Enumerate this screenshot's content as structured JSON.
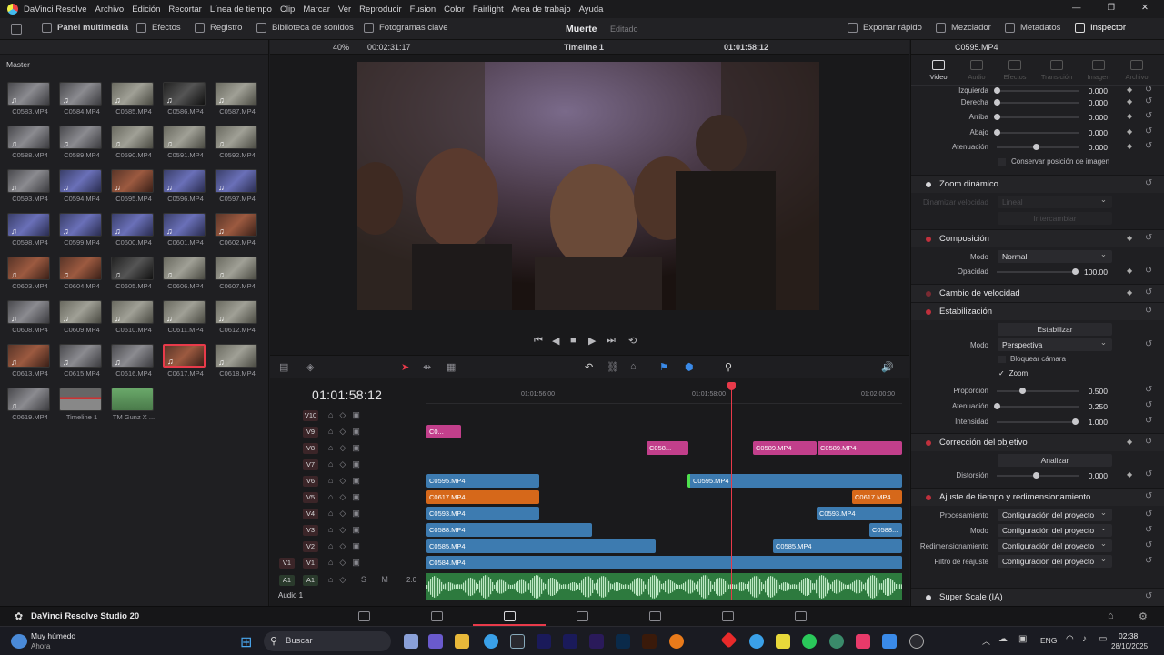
{
  "menubar": {
    "app_name": "DaVinci Resolve",
    "items": [
      "Archivo",
      "Edición",
      "Recortar",
      "Línea de tiempo",
      "Clip",
      "Marcar",
      "Ver",
      "Reproducir",
      "Fusion",
      "Color",
      "Fairlight",
      "Área de trabajo",
      "Ayuda"
    ]
  },
  "toolbar": {
    "left": [
      "Panel multimedia",
      "Efectos",
      "Registro",
      "Biblioteca de sonidos",
      "Fotogramas clave"
    ],
    "project_title": "Muerte",
    "edited_label": "Editado",
    "right": [
      "Exportar rápido",
      "Mezclador",
      "Metadatos",
      "Inspector"
    ]
  },
  "media_pool": {
    "bin": "Master",
    "clips": [
      "C0583.MP4",
      "C0584.MP4",
      "C0585.MP4",
      "C0586.MP4",
      "C0587.MP4",
      "C0588.MP4",
      "C0589.MP4",
      "C0590.MP4",
      "C0591.MP4",
      "C0592.MP4",
      "C0593.MP4",
      "C0594.MP4",
      "C0595.MP4",
      "C0596.MP4",
      "C0597.MP4",
      "C0598.MP4",
      "C0599.MP4",
      "C0600.MP4",
      "C0601.MP4",
      "C0602.MP4",
      "C0603.MP4",
      "C0604.MP4",
      "C0605.MP4",
      "C0606.MP4",
      "C0607.MP4",
      "C0608.MP4",
      "C0609.MP4",
      "C0610.MP4",
      "C0611.MP4",
      "C0612.MP4",
      "C0613.MP4",
      "C0615.MP4",
      "C0616.MP4",
      "C0617.MP4",
      "C0618.MP4",
      "C0619.MP4",
      "Timeline 1",
      "TM Gunz X ..."
    ],
    "selected": "C0617.MP4"
  },
  "viewer": {
    "zoom": "40%",
    "source_tc": "00:02:31:17",
    "timeline_name": "Timeline 1",
    "record_tc": "01:01:58:12"
  },
  "timeline": {
    "timecode": "01:01:58:12",
    "ruler": [
      "01:01:56:00",
      "01:01:58:00",
      "01:02:00:00"
    ],
    "tracks": [
      "V10",
      "V9",
      "V8",
      "V7",
      "V6",
      "V5",
      "V4",
      "V3",
      "V2",
      "V1"
    ],
    "audio_track": "A1",
    "audio_name": "Audio 1",
    "audio_level": "2.0",
    "clips": {
      "v9a": "C0...",
      "v8a": "C058...",
      "v8b": "C0589.MP4",
      "v8c": "C0589.MP4",
      "v6a": "C0595.MP4",
      "v6b": "C0595.MP4",
      "v5a": "C0617.MP4",
      "v5b": "C0617.MP4",
      "v4a": "C0593.MP4",
      "v4b": "C0593.MP4",
      "v3a": "C0588.MP4",
      "v3b": "C0588...",
      "v2a": "C0585.MP4",
      "v2b": "C0585.MP4",
      "v1a": "C0584.MP4"
    }
  },
  "inspector": {
    "clip": "C0595.MP4",
    "tabs": [
      "Video",
      "Audio",
      "Efectos",
      "Transición",
      "Imagen",
      "Archivo"
    ],
    "crop": [
      {
        "label": "Izquierda",
        "value": "0.000"
      },
      {
        "label": "Derecha",
        "value": "0.000"
      },
      {
        "label": "Arriba",
        "value": "0.000"
      },
      {
        "label": "Abajo",
        "value": "0.000"
      },
      {
        "label": "Atenuación",
        "value": "0.000"
      }
    ],
    "retain_label": "Conservar posición de imagen",
    "dynamic_zoom": "Zoom dinámico",
    "dz_ease_label": "Dinamizar velocidad",
    "dz_ease_value": "Lineal",
    "dz_swap": "Intercambiar",
    "composite": "Composición",
    "mode_label": "Modo",
    "mode_value": "Normal",
    "opacity_label": "Opacidad",
    "opacity_value": "100.00",
    "speed": "Cambio de velocidad",
    "stabilization": "Estabilización",
    "stabilize_btn": "Estabilizar",
    "stab_mode_value": "Perspectiva",
    "camera_lock": "Bloquear cámara",
    "zoom_check": "Zoom",
    "stab": [
      {
        "label": "Proporción",
        "value": "0.500"
      },
      {
        "label": "Atenuación",
        "value": "0.250"
      },
      {
        "label": "Intensidad",
        "value": "1.000"
      }
    ],
    "lens": "Corrección del objetivo",
    "analyze": "Analizar",
    "distortion_label": "Distorsión",
    "distortion_value": "0.000",
    "retime": "Ajuste de tiempo y redimensionamiento",
    "retime_rows": [
      {
        "label": "Procesamiento",
        "value": "Configuración del proyecto"
      },
      {
        "label": "Modo",
        "value": "Configuración del proyecto"
      },
      {
        "label": "Redimensionamiento",
        "value": "Configuración del proyecto"
      },
      {
        "label": "Filtro de reajuste",
        "value": "Configuración del proyecto"
      }
    ],
    "superscale": "Super Scale (IA)"
  },
  "pagebar": {
    "brand": "DaVinci Resolve Studio 20"
  },
  "taskbar": {
    "weather_main": "Muy húmedo",
    "weather_sub": "Ahora",
    "search": "Buscar",
    "lang": "ENG",
    "time": "02:38",
    "date": "28/10/2025"
  }
}
